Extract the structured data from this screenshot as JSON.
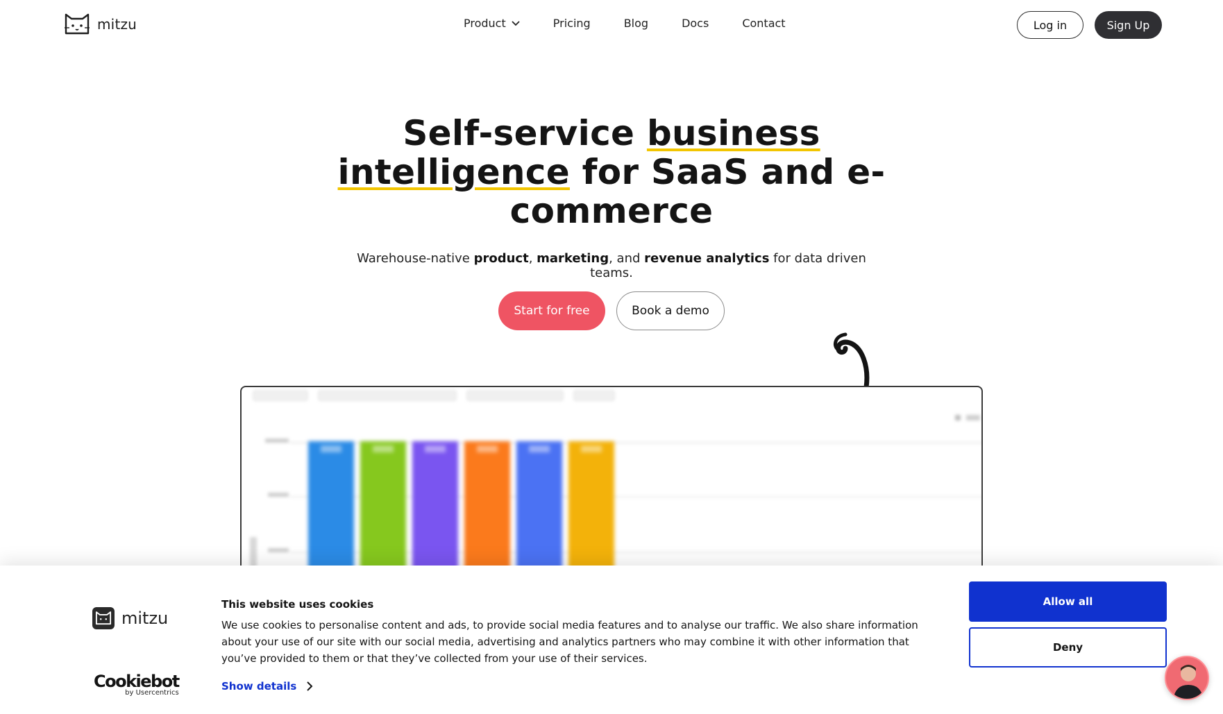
{
  "nav": {
    "brand": "mitzu",
    "items": [
      {
        "label": "Product",
        "has_dropdown": true
      },
      {
        "label": "Pricing"
      },
      {
        "label": "Blog"
      },
      {
        "label": "Docs"
      },
      {
        "label": "Contact"
      }
    ],
    "login_label": "Log in",
    "signup_label": "Sign Up"
  },
  "hero": {
    "headline_parts": [
      "Self-service ",
      "business",
      " ",
      "intelligence",
      " for SaaS and e-commerce"
    ],
    "sub_parts": [
      "Warehouse-native ",
      "product",
      ", ",
      "marketing",
      ", and ",
      "revenue analytics",
      " for data driven teams."
    ],
    "cta_primary": "Start for free",
    "cta_secondary": "Book a demo"
  },
  "preview": {
    "bar_colors": [
      "#2b8be6",
      "#86c81e",
      "#7a55f0",
      "#fb7a1c",
      "#4b72f3",
      "#f3b20a"
    ]
  },
  "cookie": {
    "brand": "mitzu",
    "title": "This website uses cookies",
    "body": "We use cookies to personalise content and ads, to provide social media features and to analyse our traffic. We also share information about your use of our site with our social media, advertising and analytics partners who may combine it with other information that you’ve provided to them or that they’ve collected from your use of their services.",
    "show_details": "Show details",
    "allow_label": "Allow all",
    "deny_label": "Deny",
    "cookiebot_name": "Cookiebot",
    "cookiebot_by": "by Usercentrics"
  },
  "colors": {
    "accent_red": "#ef5463",
    "cookie_blue": "#1032cf",
    "underline_yellow": "#f2c500",
    "dark": "#2f2f33"
  }
}
